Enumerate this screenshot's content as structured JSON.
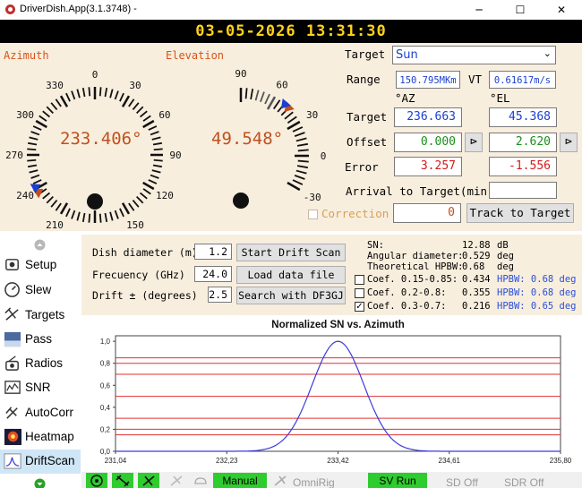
{
  "window": {
    "title": "DriverDish.App(3.1.3748) -",
    "minimize": "─",
    "maximize": "☐",
    "close": "✕"
  },
  "clock": "03-05-2026 13:31:30",
  "azimuth": {
    "label": "Azimuth",
    "value": "233.406°",
    "ticks": [
      "0",
      "30",
      "60",
      "90",
      "120",
      "150",
      "180",
      "210",
      "240",
      "270",
      "300",
      "330"
    ]
  },
  "elevation": {
    "label": "Elevation",
    "value": "49.548°",
    "ticks": [
      "90",
      "60",
      "30",
      "0",
      "-30"
    ]
  },
  "target": {
    "target_label": "Target",
    "target_value": "Sun",
    "range_label": "Range",
    "range_value": "150.795MKm",
    "vt_label": "VT",
    "vt_value": "0.61617m/s",
    "az_header": "°AZ",
    "el_header": "°EL",
    "rows": [
      {
        "label": "Target",
        "az": "236.663",
        "el": "45.368"
      },
      {
        "label": "Offset",
        "az": "0.000",
        "el": "2.620"
      },
      {
        "label": "Error",
        "az": "3.257",
        "el": "-1.556"
      }
    ],
    "arrival_label": "Arrival to Target(min)",
    "arrival_value": "",
    "correction_label": "Correction",
    "correction_value": "0",
    "track_button": "Track to Target"
  },
  "sidebar": {
    "items": [
      {
        "label": "Setup",
        "icon": "setup-icon"
      },
      {
        "label": "Slew",
        "icon": "slew-icon"
      },
      {
        "label": "Targets",
        "icon": "satellite-icon"
      },
      {
        "label": "Pass",
        "icon": "pass-icon"
      },
      {
        "label": "Radios",
        "icon": "radio-icon"
      },
      {
        "label": "SNR",
        "icon": "snr-icon"
      },
      {
        "label": "AutoCorr",
        "icon": "autocorr-icon"
      },
      {
        "label": "Heatmap",
        "icon": "heatmap-icon"
      },
      {
        "label": "DriftScan",
        "icon": "driftscan-icon"
      }
    ]
  },
  "drift": {
    "dish_label": "Dish diameter (m)",
    "dish_value": "1.2",
    "freq_label": "Frecuency (GHz)",
    "freq_value": "24.0",
    "drift_label": "Drift ± (degrees)",
    "drift_value": "2.5",
    "start_button": "Start Drift Scan",
    "load_button": "Load data file",
    "search_button": "Search with DF3GJ",
    "sn_label": "SN:",
    "sn_value": "12.88",
    "sn_unit": "dB",
    "ang_label": "Angular diameter:",
    "ang_value": "0.529",
    "ang_unit": "deg",
    "hpbw_label": "Theoretical HPBW:",
    "hpbw_value": "0.68",
    "hpbw_unit": "deg",
    "coefs": [
      {
        "label": "Coef. 0.15-0.85:",
        "value": "0.434",
        "hpbw": "HPBW: 0.68 deg",
        "checked": false
      },
      {
        "label": "Coef. 0.2-0.8:",
        "value": "0.355",
        "hpbw": "HPBW: 0.68 deg",
        "checked": false
      },
      {
        "label": "Coef. 0.3-0.7:",
        "value": "0.216",
        "hpbw": "HPBW: 0.65 deg",
        "checked": true
      }
    ]
  },
  "chart_data": {
    "type": "line",
    "title": "Normalized SN vs. Azimuth",
    "xlabel": "",
    "ylabel": "",
    "xlim": [
      231.04,
      235.8
    ],
    "ylim": [
      0,
      1.05
    ],
    "x_ticks": [
      "231,04",
      "232,23",
      "233,42",
      "234,61",
      "235,80"
    ],
    "y_ticks": [
      "0,0",
      "0,2",
      "0,4",
      "0,6",
      "0,8",
      "1,0"
    ],
    "hlines": [
      0.15,
      0.2,
      0.3,
      0.5,
      0.7,
      0.8,
      0.85
    ],
    "series": [
      {
        "peak_x": 233.42,
        "peak_y": 1.0,
        "hpbw": 0.65
      }
    ],
    "line_color": "#3c3cdc",
    "hline_color": "#e23030"
  },
  "bottom": {
    "manual": "Manual",
    "omnirig": "OmniRig",
    "sv_run": "SV Run",
    "sd_off": "SD Off",
    "sdr_off": "SDR Off"
  }
}
